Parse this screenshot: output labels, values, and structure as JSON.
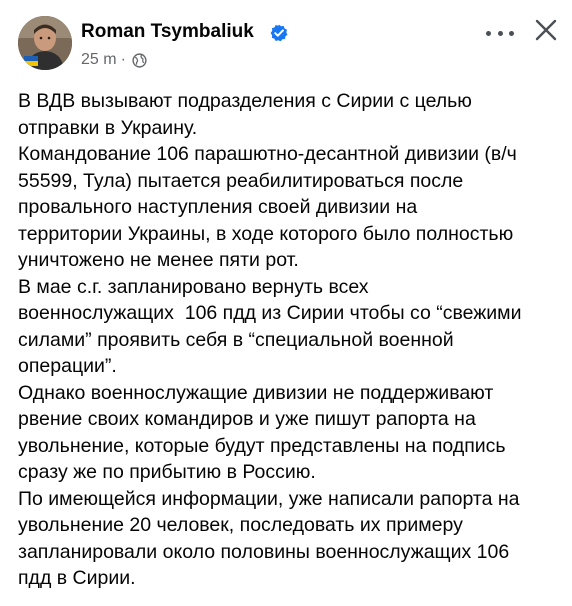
{
  "header": {
    "author_name": "Roman Tsymbaliuk",
    "timestamp": "25 m",
    "separator": "·",
    "verified_icon": "verified-badge-icon",
    "privacy_icon": "globe-icon",
    "more_icon": "more-options-icon",
    "close_icon": "close-icon",
    "colors": {
      "verified_blue": "#1877f2",
      "meta_gray": "#65676b",
      "text": "#050505"
    }
  },
  "post": {
    "lines": [
      "В ВДВ вызывают подразделения с Сирии с целью",
      "отправки в Украину.",
      "Командование 106 парашютно-десантной дивизии (в/ч",
      "55599, Тула) пытается реабилитироваться после",
      "провального наступления своей дивизии на",
      "территории Украины, в ходе которого было полностью",
      "уничтожено не менее пяти рот.",
      "В мае с.г. запланировано вернуть всех",
      "военнослужащих  106 пдд из Сирии чтобы со “свежими",
      "силами” проявить себя в “специальной военной",
      "операции”.",
      "Однако военнослужащие дивизии не поддерживают",
      "рвение своих командиров и уже пишут рапорта на",
      "увольнение, которые будут представлены на подпись",
      "сразу же по прибытию в Россию.",
      "По имеющейся информации, уже написали рапорта на",
      "увольнение 20 человек, последовать их примеру",
      "запланировали около половины военнослужащих 106",
      "пдд в Сирии."
    ]
  }
}
